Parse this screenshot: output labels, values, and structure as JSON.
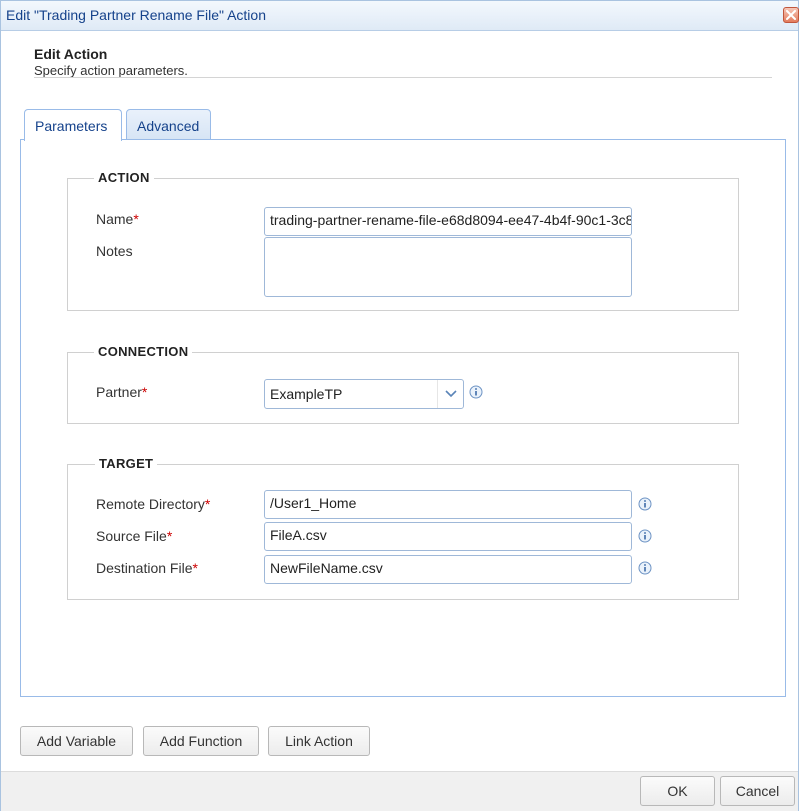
{
  "window": {
    "title": "Edit \"Trading Partner Rename File\" Action",
    "close_icon": "close-icon"
  },
  "header": {
    "title": "Edit Action",
    "subtitle": "Specify action parameters."
  },
  "tabs": [
    {
      "label": "Parameters",
      "active": true
    },
    {
      "label": "Advanced",
      "active": false
    }
  ],
  "action_section": {
    "legend": "ACTION",
    "name_label": "Name",
    "name_value": "trading-partner-rename-file-e68d8094-ee47-4b4f-90c1-3c8",
    "notes_label": "Notes",
    "notes_value": ""
  },
  "connection_section": {
    "legend": "CONNECTION",
    "partner_label": "Partner",
    "partner_value": "ExampleTP"
  },
  "target_section": {
    "legend": "TARGET",
    "remote_dir_label": "Remote Directory",
    "remote_dir_value": "/User1_Home",
    "source_file_label": "Source File",
    "source_file_value": "FileA.csv",
    "dest_file_label": "Destination File",
    "dest_file_value": "NewFileName.csv"
  },
  "required_marker": "*",
  "buttons": {
    "add_variable": "Add Variable",
    "add_function": "Add Function",
    "link_action": "Link Action",
    "ok": "OK",
    "cancel": "Cancel"
  },
  "colors": {
    "accent": "#15428b",
    "border": "#99bbe8",
    "required": "#cc0000"
  }
}
